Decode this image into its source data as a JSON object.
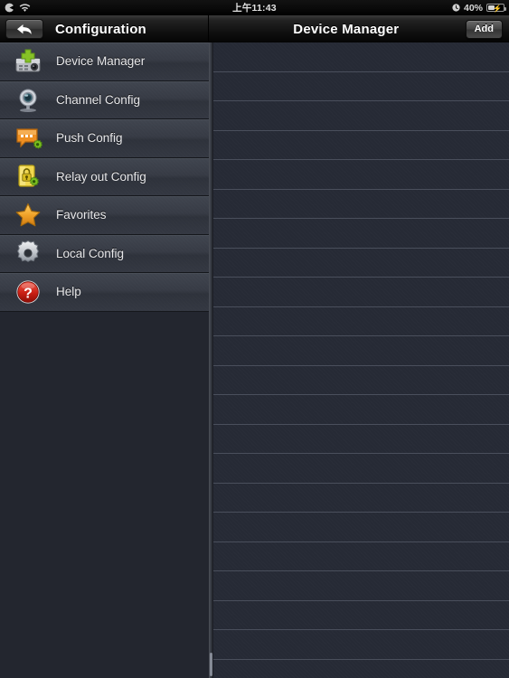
{
  "status_bar": {
    "location_icon": "location-services-icon",
    "wifi_icon": "wifi-icon",
    "time": "上午11:43",
    "alarm_icon": "alarm-clock-icon",
    "battery_percent": "40%",
    "battery_level": 40,
    "battery_icon": "battery-charging-icon"
  },
  "nav": {
    "back_icon": "back-arrow-icon",
    "left_title": "Configuration",
    "right_title": "Device Manager",
    "add_label": "Add"
  },
  "sidebar": {
    "items": [
      {
        "label": "Device Manager",
        "icon": "device-manager-icon"
      },
      {
        "label": "Channel Config",
        "icon": "camera-icon"
      },
      {
        "label": "Push Config",
        "icon": "push-message-icon"
      },
      {
        "label": "Relay out Config",
        "icon": "relay-lock-icon"
      },
      {
        "label": "Favorites",
        "icon": "star-icon"
      },
      {
        "label": "Local Config",
        "icon": "gear-icon"
      },
      {
        "label": "Help",
        "icon": "help-question-icon"
      }
    ]
  },
  "device_list": {
    "rows": 21,
    "empty": true
  },
  "colors": {
    "sidebar_row_top": "#40454f",
    "sidebar_row_bottom": "#343842",
    "panel_background": "#262a35",
    "row_separator": "#4a4f5c",
    "navbar_dark": "#111111",
    "accent_green": "#7cc120",
    "accent_orange": "#f09a2a",
    "accent_red": "#cc2222"
  }
}
